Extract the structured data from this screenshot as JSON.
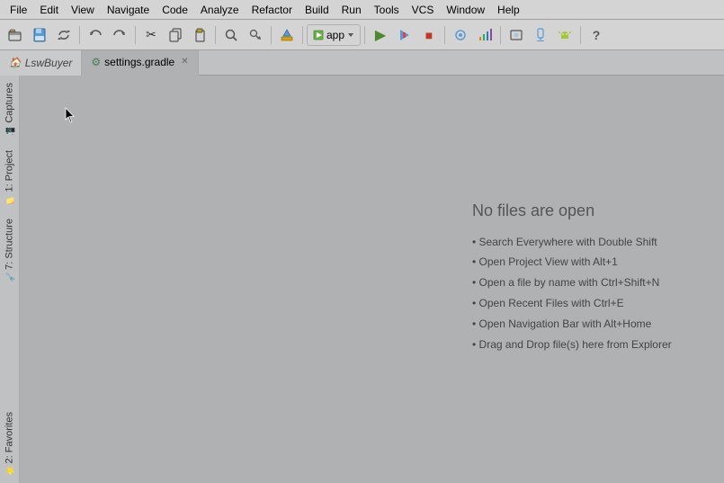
{
  "menubar": {
    "items": [
      "File",
      "Edit",
      "View",
      "Navigate",
      "Code",
      "Analyze",
      "Refactor",
      "Build",
      "Run",
      "Tools",
      "VCS",
      "Window",
      "Help"
    ]
  },
  "toolbar": {
    "run_config": "app",
    "buttons": [
      {
        "icon": "📁",
        "name": "open-button"
      },
      {
        "icon": "💾",
        "name": "save-button"
      },
      {
        "icon": "🔄",
        "name": "sync-button"
      },
      {
        "sep": true
      },
      {
        "icon": "↩",
        "name": "undo-button"
      },
      {
        "icon": "↪",
        "name": "redo-button"
      },
      {
        "sep": true
      },
      {
        "icon": "✂",
        "name": "cut-button"
      },
      {
        "icon": "📋",
        "name": "copy-button"
      },
      {
        "icon": "📌",
        "name": "paste-button"
      },
      {
        "sep": true
      },
      {
        "icon": "🔍",
        "name": "find-button"
      },
      {
        "icon": "🔎",
        "name": "find-replace-button"
      },
      {
        "sep": true
      }
    ]
  },
  "tabs": [
    {
      "label": "LswBuyer",
      "type": "project",
      "icon": "🏠",
      "active": false
    },
    {
      "label": "settings.gradle",
      "type": "file",
      "icon": "⚙",
      "active": true,
      "closeable": true
    }
  ],
  "side_panels": [
    {
      "label": "Captures",
      "icon": "📷",
      "name": "captures"
    },
    {
      "label": "1: Project",
      "icon": "📁",
      "name": "project"
    },
    {
      "label": "7: Structure",
      "icon": "🔧",
      "name": "structure"
    },
    {
      "label": "2: Favorites",
      "icon": "⭐",
      "name": "favorites"
    }
  ],
  "content": {
    "no_files_title": "No files are open",
    "hints": [
      {
        "text": "Search Everywhere with Double Shift"
      },
      {
        "text": "Open Project View with Alt+1"
      },
      {
        "text": "Open a file by name with Ctrl+Shift+N"
      },
      {
        "text": "Open Recent Files with Ctrl+E"
      },
      {
        "text": "Open Navigation Bar with Alt+Home"
      },
      {
        "text": "Drag and Drop file(s) here from Explorer"
      }
    ]
  },
  "colors": {
    "bg": "#afb1b3",
    "toolbar_bg": "#d4d4d4",
    "tab_active_bg": "#afb1b3"
  }
}
